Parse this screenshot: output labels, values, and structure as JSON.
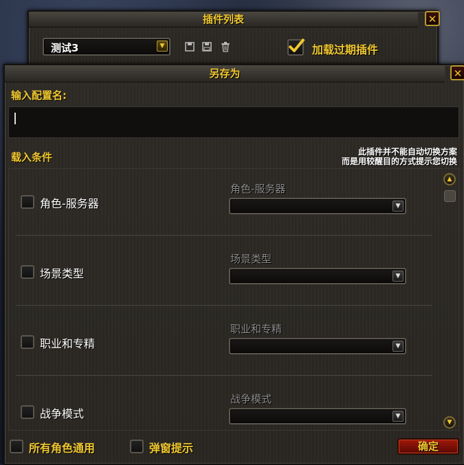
{
  "addon_list_window": {
    "title": "插件列表",
    "close_glyph": "✕",
    "profile_dropdown": {
      "value": "测试3"
    },
    "load_outdated": {
      "label": "加载过期插件",
      "checked": true
    }
  },
  "save_as_dialog": {
    "title": "另存为",
    "close_glyph": "✕",
    "name_label": "输入配置名:",
    "name_input_value": "",
    "load_conditions_label": "载入条件",
    "note_line1": "此插件并不能自动切换方案",
    "note_line2": "而是用较醒目的方式提示您切换",
    "conditions": [
      {
        "checkbox_label": "角色-服务器",
        "dropdown_label": "角色-服务器",
        "dropdown_value": ""
      },
      {
        "checkbox_label": "场景类型",
        "dropdown_label": "场景类型",
        "dropdown_value": ""
      },
      {
        "checkbox_label": "职业和专精",
        "dropdown_label": "职业和专精",
        "dropdown_value": ""
      },
      {
        "checkbox_label": "战争模式",
        "dropdown_label": "战争模式",
        "dropdown_value": ""
      }
    ],
    "all_characters_label": "所有角色通用",
    "popup_hint_label": "弹窗提示",
    "confirm_label": "确定"
  },
  "colors": {
    "title_gold": "#f0c830",
    "confirm_red": "#8a1208",
    "text_white": "#ffffff",
    "text_disabled": "#8a8a8a"
  },
  "icons": [
    "close-icon",
    "dropdown-arrow-icon",
    "save-icon",
    "save-as-icon",
    "trash-icon",
    "checkmark-icon",
    "scroll-up-icon",
    "scroll-down-icon"
  ]
}
